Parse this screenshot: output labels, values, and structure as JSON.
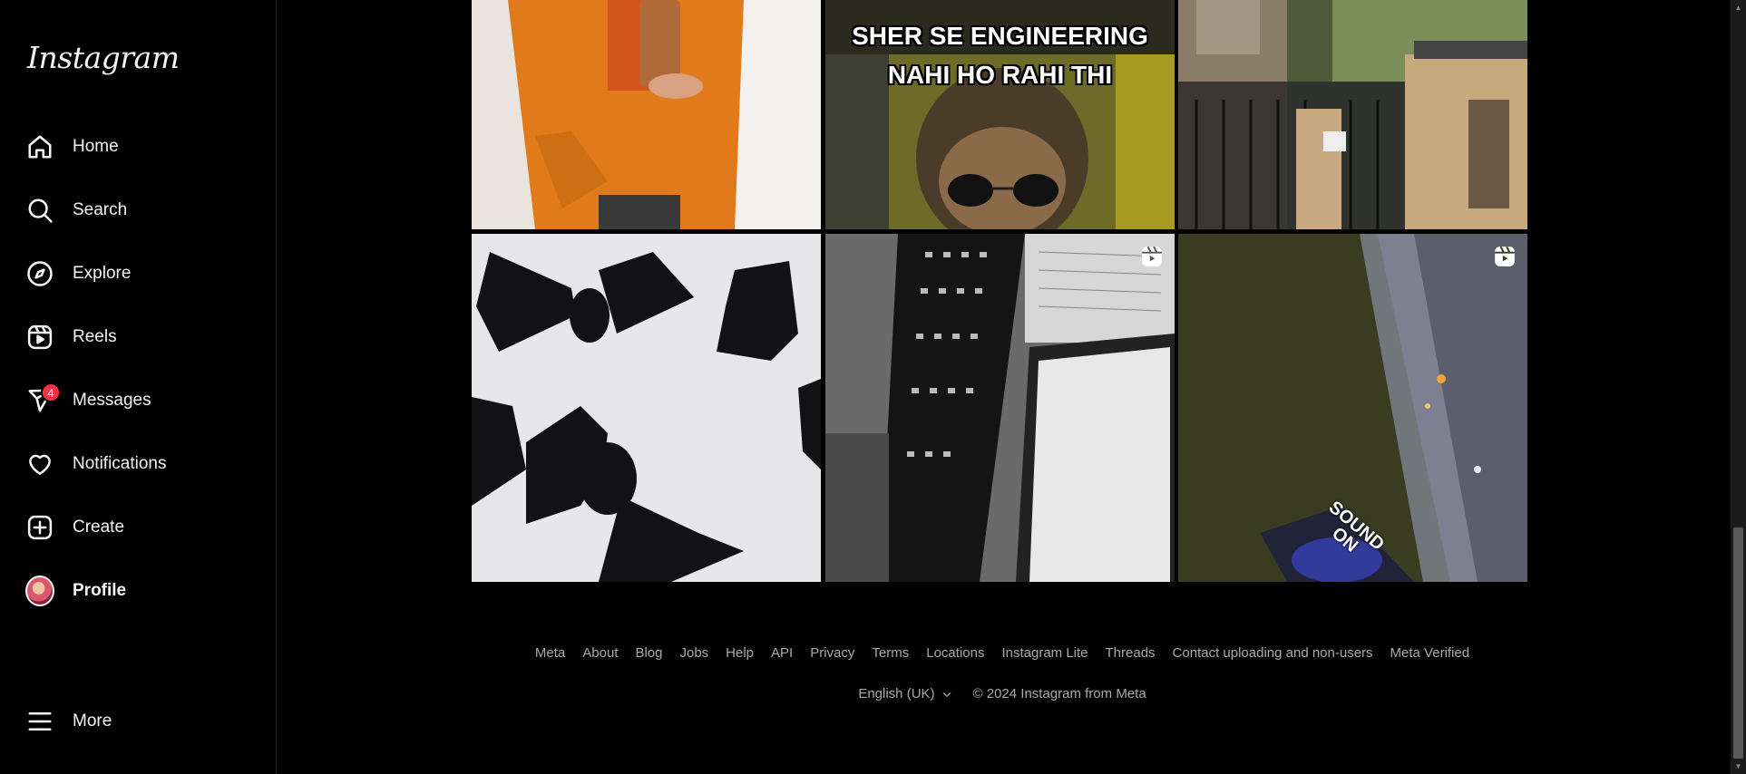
{
  "app": {
    "logo": "Instagram"
  },
  "sidebar": {
    "items": [
      {
        "label": "Home",
        "icon": "home-icon"
      },
      {
        "label": "Search",
        "icon": "search-icon"
      },
      {
        "label": "Explore",
        "icon": "compass-icon"
      },
      {
        "label": "Reels",
        "icon": "reels-icon"
      },
      {
        "label": "Messages",
        "icon": "messenger-icon",
        "badge": "4"
      },
      {
        "label": "Notifications",
        "icon": "heart-icon"
      },
      {
        "label": "Create",
        "icon": "plus-square-icon"
      },
      {
        "label": "Profile",
        "icon": "avatar"
      }
    ],
    "more": "More"
  },
  "grid": {
    "meme_line1": "SHER SE ENGINEERING",
    "meme_line2": "NAHI HO RAHI THI",
    "sound_on": "SOUND ON"
  },
  "footer": {
    "links": [
      "Meta",
      "About",
      "Blog",
      "Jobs",
      "Help",
      "API",
      "Privacy",
      "Terms",
      "Locations",
      "Instagram Lite",
      "Threads",
      "Contact uploading and non-users",
      "Meta Verified"
    ],
    "language": "English (UK)",
    "copyright": "© 2024 Instagram from Meta"
  },
  "colors": {
    "background": "#000000",
    "text": "#f5f5f5",
    "muted": "#a8a8a8",
    "badge": "#ff3040"
  }
}
